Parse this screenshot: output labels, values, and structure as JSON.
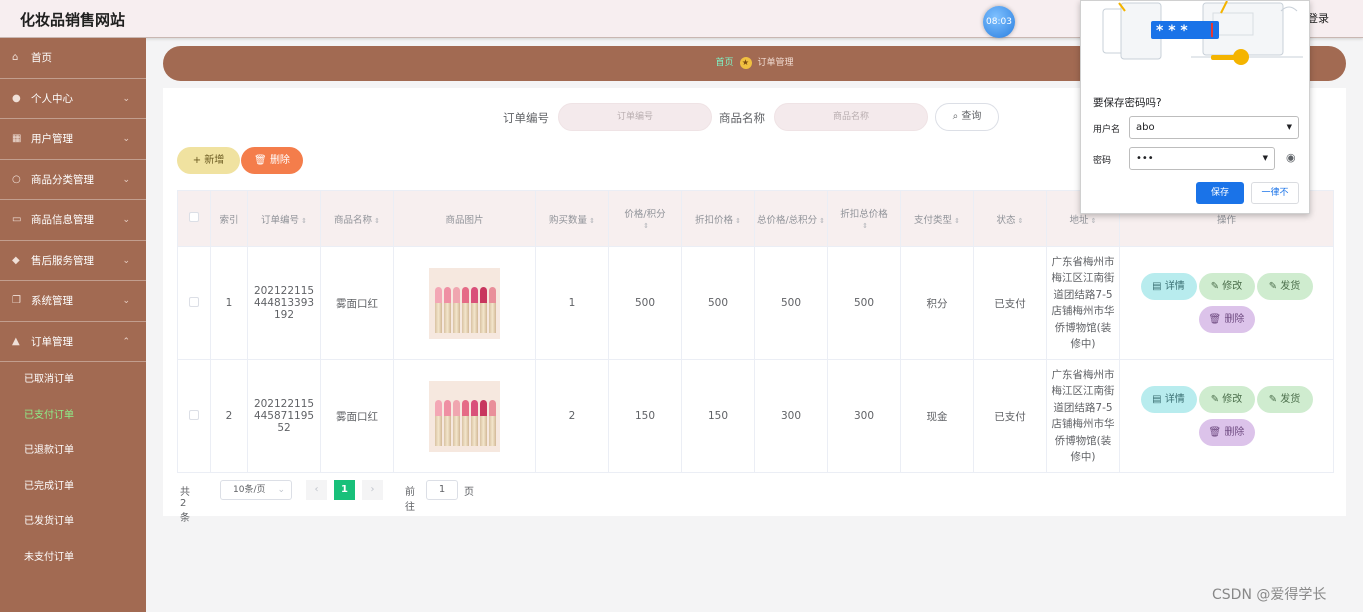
{
  "header": {
    "title": "化妆品销售网站",
    "clock": "08:03",
    "login_label": "登录"
  },
  "sidebar": {
    "items": [
      {
        "label": "首页",
        "icon": "home-icon",
        "arrow": false
      },
      {
        "label": "个人中心",
        "icon": "user-icon",
        "arrow": true
      },
      {
        "label": "用户管理",
        "icon": "users-icon",
        "arrow": true
      },
      {
        "label": "商品分类管理",
        "icon": "category-icon",
        "arrow": true
      },
      {
        "label": "商品信息管理",
        "icon": "goods-icon",
        "arrow": true
      },
      {
        "label": "售后服务管理",
        "icon": "service-icon",
        "arrow": true
      },
      {
        "label": "系统管理",
        "icon": "system-icon",
        "arrow": true
      },
      {
        "label": "订单管理",
        "icon": "order-icon",
        "arrow": true
      }
    ],
    "sub_items": [
      {
        "label": "已取消订单",
        "active": false
      },
      {
        "label": "已支付订单",
        "active": true
      },
      {
        "label": "已退款订单",
        "active": false
      },
      {
        "label": "已完成订单",
        "active": false
      },
      {
        "label": "已发货订单",
        "active": false
      },
      {
        "label": "未支付订单",
        "active": false
      }
    ]
  },
  "breadcrumb": {
    "home": "首页",
    "current": "订单管理"
  },
  "search": {
    "order_no_label": "订单编号",
    "order_no_placeholder": "订单编号",
    "goods_name_label": "商品名称",
    "goods_name_placeholder": "商品名称",
    "query_label": "查询"
  },
  "toolbar": {
    "add_label": "新增",
    "delete_label": "删除"
  },
  "table": {
    "headers": {
      "index": "索引",
      "order_no": "订单编号",
      "goods_name": "商品名称",
      "goods_image": "商品图片",
      "quantity": "购买数量",
      "price": "价格/积分",
      "discount_price": "折扣价格",
      "total": "总价格/总积分",
      "discount_total": "折扣总价格",
      "pay_type": "支付类型",
      "status": "状态",
      "address": "地址",
      "actions": "操作"
    },
    "rows": [
      {
        "index": "1",
        "order_no": "202122115444813393192",
        "goods_name": "雾面口红",
        "quantity": "1",
        "price": "500",
        "discount_price": "500",
        "total": "500",
        "discount_total": "500",
        "pay_type": "积分",
        "status": "已支付",
        "address": "广东省梅州市梅江区江南街道团结路7-5店铺梅州市华侨博物馆(装修中)"
      },
      {
        "index": "2",
        "order_no": "20212211544587119552",
        "goods_name": "雾面口红",
        "quantity": "2",
        "price": "150",
        "discount_price": "150",
        "total": "300",
        "discount_total": "300",
        "pay_type": "现金",
        "status": "已支付",
        "address": "广东省梅州市梅江区江南街道团结路7-5店铺梅州市华侨博物馆(装修中)"
      }
    ],
    "actions": {
      "detail": "详情",
      "edit": "修改",
      "ship": "发货",
      "delete": "删除"
    }
  },
  "pagination": {
    "total_text": "共 2 条",
    "page_size": "10条/页",
    "current_page": "1",
    "goto_label": "前往",
    "goto_value": "1",
    "page_unit": "页"
  },
  "password_popup": {
    "question": "要保存密码吗?",
    "username_label": "用户名",
    "username_value": "abo",
    "password_label": "密码",
    "password_value": "•••",
    "save_label": "保存",
    "never_label": "一律不",
    "illustration_text": "* * *"
  },
  "watermark": "CSDN @爱得学长"
}
